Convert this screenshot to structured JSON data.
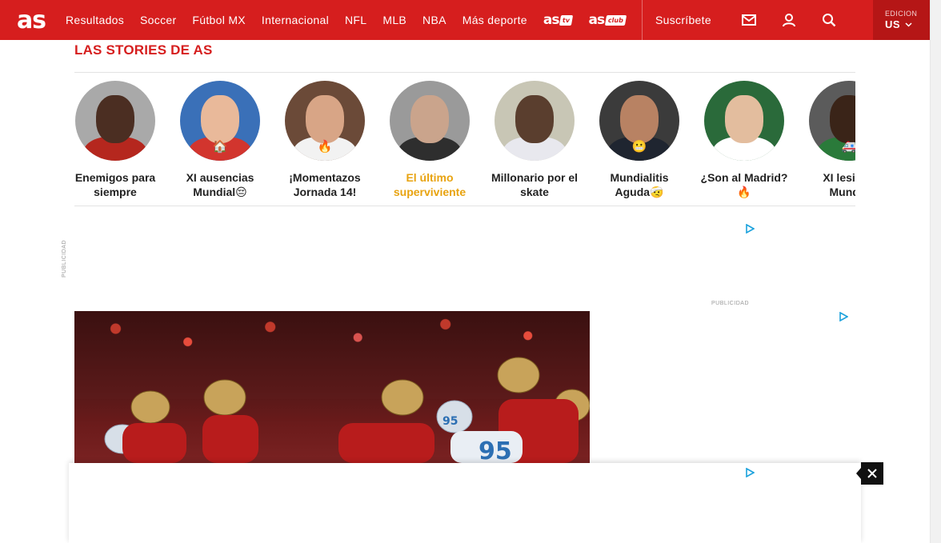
{
  "colors": {
    "brand": "#d61e1e",
    "edition_bg": "#b51616",
    "active_caption": "#e8a310",
    "adchoice": "#1aa1dc"
  },
  "header": {
    "logo": "as",
    "nav": [
      "Resultados",
      "Soccer",
      "Fútbol MX",
      "Internacional",
      "NFL",
      "MLB",
      "NBA",
      "Más deporte"
    ],
    "brand_tv": {
      "name": "as",
      "tag": "tv"
    },
    "brand_club": {
      "name": "as",
      "tag": "club"
    },
    "subscribe": "Suscríbete",
    "icons": [
      "mail-icon",
      "user-icon",
      "search-icon"
    ],
    "edition": {
      "label": "EDICION",
      "value": "US"
    }
  },
  "stories": {
    "title": "LAS STORIES DE AS",
    "items": [
      {
        "caption": "Enemigos para siempre",
        "emoji": "",
        "active": false
      },
      {
        "caption": "XI ausencias Mundial😔",
        "emoji": "🏠",
        "active": false
      },
      {
        "caption": "¡Momentazos Jornada 14!",
        "emoji": "🔥",
        "active": false
      },
      {
        "caption": "El último superviviente",
        "emoji": "",
        "active": true
      },
      {
        "caption": "Millonario por el skate",
        "emoji": "",
        "active": false
      },
      {
        "caption": "Mundialitis Aguda🤕",
        "emoji": "😬",
        "active": false
      },
      {
        "caption": "¿Son al Madrid?🔥",
        "emoji": "",
        "active": false
      },
      {
        "caption": "XI lesiona Mundia",
        "emoji": "🚑",
        "active": false
      }
    ]
  },
  "ads": {
    "side_label": "PUBLICIDAD",
    "right_label": "PUBLICIDAD"
  }
}
